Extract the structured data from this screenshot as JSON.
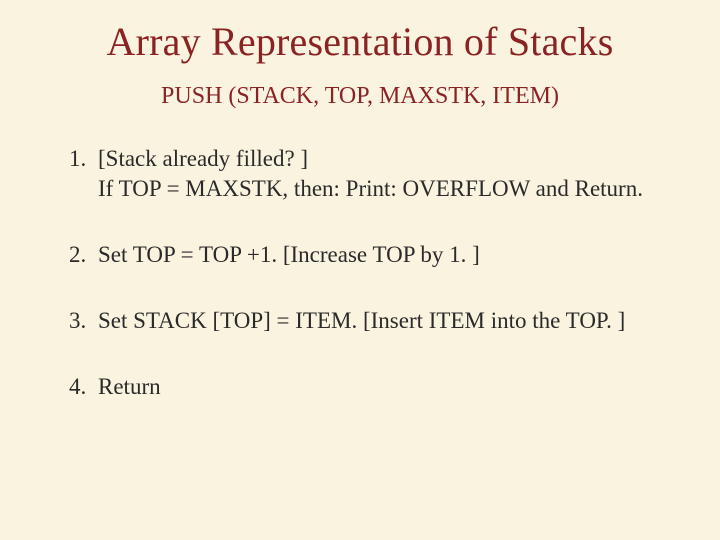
{
  "title": "Array Representation of Stacks",
  "subtitle": "PUSH (STACK, TOP, MAXSTK, ITEM)",
  "steps": [
    {
      "lines": [
        "[Stack already filled? ]",
        "If TOP = MAXSTK, then: Print: OVERFLOW and Return."
      ]
    },
    {
      "lines": [
        "Set TOP = TOP +1. [Increase TOP by 1. ]"
      ]
    },
    {
      "lines": [
        "Set STACK [TOP] = ITEM. [Insert ITEM into the TOP. ]"
      ]
    },
    {
      "lines": [
        "Return"
      ]
    }
  ]
}
